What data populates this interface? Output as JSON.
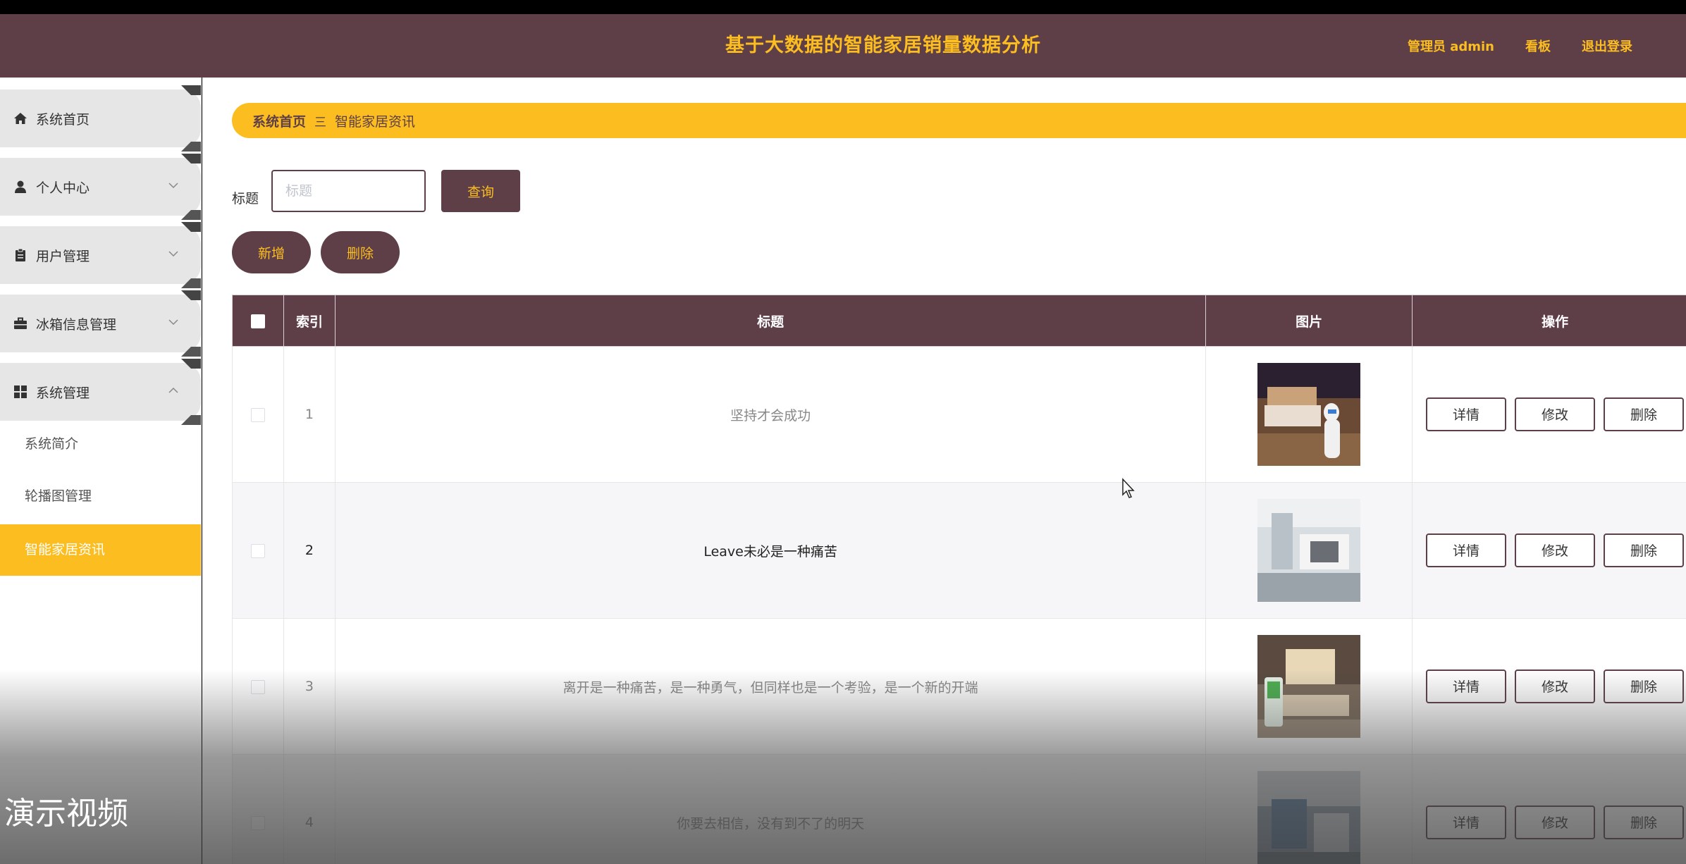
{
  "header": {
    "title": "基于大数据的智能家居销量数据分析",
    "admin_link": "管理员 admin",
    "board_link": "看板",
    "logout_link": "退出登录",
    "bg_color": "#5e3f47",
    "accent_color": "#fbbd20"
  },
  "sidebar": {
    "items": [
      {
        "label": "系统首页",
        "icon": "home-icon"
      },
      {
        "label": "个人中心",
        "icon": "person-icon"
      },
      {
        "label": "用户管理",
        "icon": "clipboard-icon"
      },
      {
        "label": "冰箱信息管理",
        "icon": "briefcase-icon"
      },
      {
        "label": "系统管理",
        "icon": "grid-icon"
      }
    ],
    "sub_items": [
      {
        "label": "系统简介"
      },
      {
        "label": "轮播图管理"
      },
      {
        "label": "智能家居资讯",
        "active": true
      }
    ]
  },
  "breadcrumb": {
    "home": "系统首页",
    "separator": "三",
    "current": "智能家居资讯"
  },
  "search": {
    "label": "标题",
    "placeholder": "标题",
    "value": "",
    "query_button": "查询"
  },
  "actions": {
    "add_button": "新增",
    "delete_button": "删除"
  },
  "table": {
    "headers": {
      "index": "索引",
      "title": "标题",
      "image": "图片",
      "actions": "操作"
    },
    "rows": [
      {
        "index": "1",
        "title": "坚持才会成功"
      },
      {
        "index": "2",
        "title": "Leave未必是一种痛苦"
      },
      {
        "index": "3",
        "title": "离开是一种痛苦，是一种勇气，但同样也是一个考验，是一个新的开端"
      },
      {
        "index": "4",
        "title": "你要去相信，没有到不了的明天"
      }
    ],
    "row_buttons": {
      "detail": "详情",
      "edit": "修改",
      "delete": "删除"
    }
  },
  "overlay": {
    "watermark": "演示视频"
  }
}
